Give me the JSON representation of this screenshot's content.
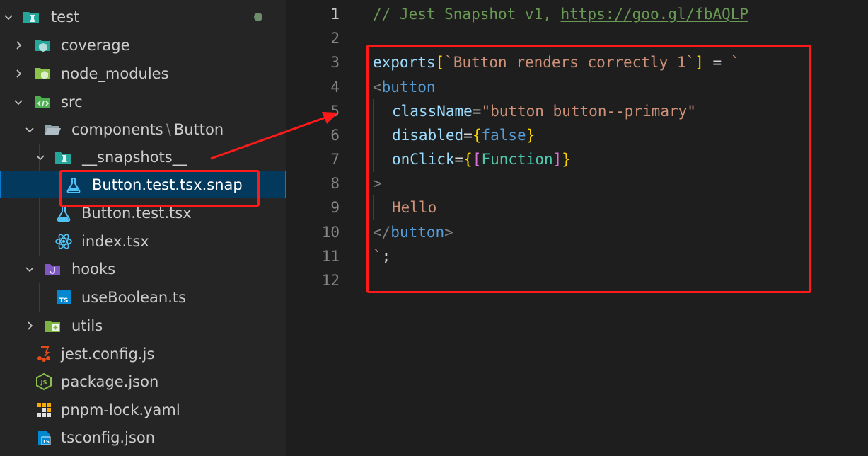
{
  "explorer": {
    "items": [
      {
        "label": "test",
        "icon": "test-folder-icon",
        "chevron": "down",
        "indent": 0
      },
      {
        "label": "coverage",
        "icon": "coverage-folder-icon",
        "chevron": "right",
        "indent": 1
      },
      {
        "label": "node_modules",
        "icon": "node-folder-icon",
        "chevron": "right",
        "indent": 1
      },
      {
        "label": "src",
        "icon": "src-folder-icon",
        "chevron": "down",
        "indent": 1
      },
      {
        "label": "components",
        "label_suffix": "Button",
        "icon": "folder-open-icon",
        "chevron": "down",
        "indent": 2
      },
      {
        "label": "__snapshots__",
        "icon": "test-folder-icon",
        "chevron": "down",
        "indent": 3
      },
      {
        "label": "Button.test.tsx.snap",
        "icon": "flask-icon",
        "indent": 4,
        "selected": true
      },
      {
        "label": "Button.test.tsx",
        "icon": "flask-icon",
        "indent": 3
      },
      {
        "label": "index.tsx",
        "icon": "react-icon",
        "indent": 3
      },
      {
        "label": "hooks",
        "icon": "hooks-folder-icon",
        "chevron": "down",
        "indent": 2
      },
      {
        "label": "useBoolean.ts",
        "icon": "typescript-icon",
        "indent": 3
      },
      {
        "label": "utils",
        "icon": "utils-folder-icon",
        "chevron": "right",
        "indent": 2
      },
      {
        "label": "jest.config.js",
        "icon": "jest-icon",
        "indent": 1
      },
      {
        "label": "package.json",
        "icon": "nodejs-icon",
        "indent": 1
      },
      {
        "label": "pnpm-lock.yaml",
        "icon": "pnpm-icon",
        "indent": 1
      },
      {
        "label": "tsconfig.json",
        "icon": "tsconfig-icon",
        "indent": 1
      }
    ],
    "path_separator": "\\"
  },
  "editor": {
    "line_numbers": [
      "1",
      "2",
      "3",
      "4",
      "5",
      "6",
      "7",
      "8",
      "9",
      "10",
      "11",
      "12"
    ],
    "active_line": "1",
    "lines": {
      "l1": {
        "comment": "// Jest Snapshot v1, ",
        "link": "https://goo.gl/fbAQLP"
      },
      "l3": {
        "exports": "exports",
        "open": "[",
        "str": "`Button renders correctly 1`",
        "close": "]",
        "eq": " = ",
        "tick": "`"
      },
      "l4": {
        "lt": "<",
        "tag": "button"
      },
      "l5": {
        "attr": "className",
        "eq": "=",
        "val": "\"button button--primary\""
      },
      "l6": {
        "attr": "disabled",
        "eq": "=",
        "open": "{",
        "val": "false",
        "close": "}"
      },
      "l7": {
        "attr": "onClick",
        "eq": "=",
        "open": "{",
        "open2": "[",
        "val": "Function",
        "close2": "]",
        "close": "}"
      },
      "l8": {
        "gt": ">"
      },
      "l9": {
        "text": "Hello"
      },
      "l10": {
        "lt": "</",
        "tag": "button",
        "gt": ">"
      },
      "l11": {
        "tick": "`",
        "semi": ";"
      }
    }
  },
  "colors": {
    "annotation": "#ff1a1a",
    "selection": "#04395e",
    "sidebar_bg": "#252526",
    "editor_bg": "#1e1e1e"
  }
}
